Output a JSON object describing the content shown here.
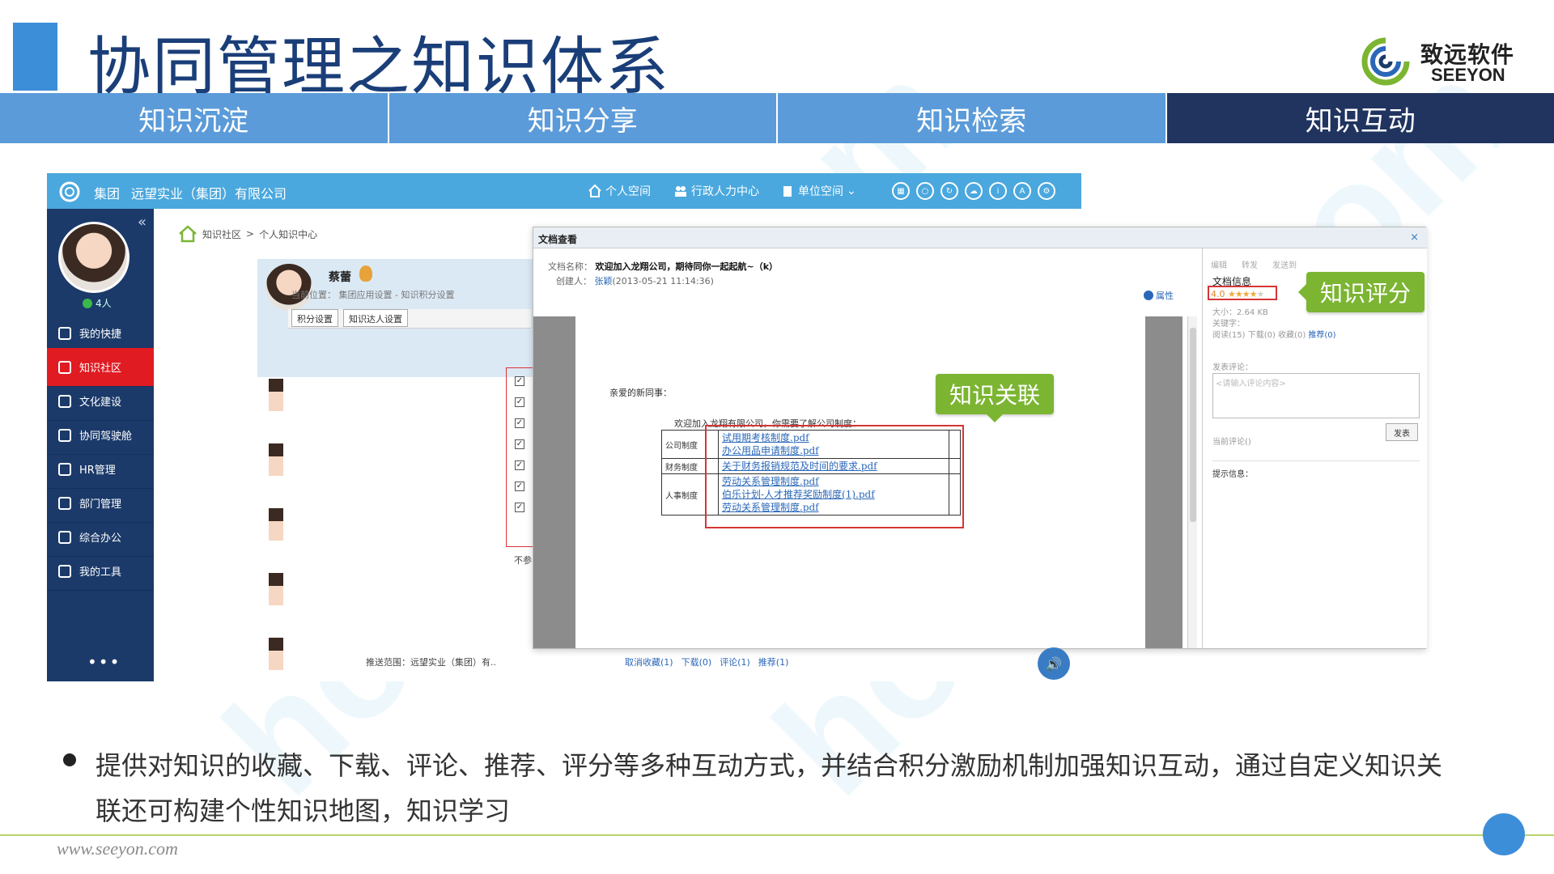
{
  "slide": {
    "title": "协同管理之知识体系",
    "logo_cn": "致远软件",
    "logo_en": "SEEYON",
    "tabs": [
      "知识沉淀",
      "知识分享",
      "知识检索",
      "知识互动"
    ],
    "active_tab_index": 3,
    "bullet_text": "提供对知识的收藏、下载、评论、推荐、评分等多种互动方式，并结合积分激励机制加强知识互动，通过自定义知识关联还可构建个性知识地图，知识学习",
    "footer_url": "www.seeyon.com",
    "watermark": "homedo.com",
    "colors": {
      "tab": "#5b9bd9",
      "tab_active": "#20345f",
      "title": "#1a3e78",
      "callout": "#7cb532",
      "accent_red": "#e01b22"
    }
  },
  "app": {
    "topbar": {
      "group": "集团",
      "company": "远望实业（集团）有限公司",
      "nav": [
        "个人空间",
        "行政人力中心",
        "单位空间"
      ],
      "icons": [
        "grid-icon",
        "search-icon",
        "refresh-icon",
        "cloud-icon",
        "info-icon",
        "text-size-icon",
        "settings-icon"
      ]
    },
    "sidebar": {
      "online": "4人",
      "items": [
        {
          "label": "我的快捷",
          "icon": "plus-icon"
        },
        {
          "label": "知识社区",
          "icon": "book-icon",
          "active": true
        },
        {
          "label": "文化建设",
          "icon": "building-icon"
        },
        {
          "label": "协同驾驶舱",
          "icon": "dashboard-icon"
        },
        {
          "label": "HR管理",
          "icon": "id-card-icon"
        },
        {
          "label": "部门管理",
          "icon": "org-chart-icon"
        },
        {
          "label": "综合办公",
          "icon": "office-icon"
        },
        {
          "label": "我的工具",
          "icon": "toolbox-icon"
        }
      ],
      "more": "•••"
    },
    "breadcrumb": {
      "root": "知识社区",
      "sep": ">",
      "current": "个人知识中心"
    },
    "person": {
      "name": "蔡蕾",
      "path": "当前位置：   集团应用设置 - 知识积分设置",
      "tabs": [
        "积分设置",
        "知识达人设置"
      ]
    },
    "content_note": "推送范围：远望实业（集团）有..",
    "not_shown": "不参",
    "actions": [
      "取消收藏(1)",
      "下载(0)",
      "评论(1)",
      "推荐(1)"
    ]
  },
  "viewer": {
    "title": "文档查看",
    "close": "×",
    "doc_name_label": "文档名称：",
    "doc_name": "欢迎加入龙翔公司，期待同你一起起航~（k）",
    "creator_label": "创建人：",
    "creator": "张颖",
    "created": "(2013-05-21 11:14:36)",
    "property": "属性",
    "greeting": "亲爱的新同事：",
    "intro": "欢迎加入龙翔有限公司，你需要了解公司制度：",
    "policies": [
      {
        "category": "公司制度",
        "files": [
          "试用期考核制度.pdf",
          "办公用品申请制度.pdf"
        ]
      },
      {
        "category": "财务制度",
        "files": [
          "关于财务报销规范及时间的要求.pdf"
        ]
      },
      {
        "category": "人事制度",
        "files": [
          "劳动关系管理制度.pdf",
          "伯乐计划-人才推荐奖励制度(1).pdf",
          "劳动关系管理制度.pdf"
        ]
      }
    ],
    "right": {
      "toolbar": [
        "编辑",
        "转发",
        "发送到"
      ],
      "section": "文档信息",
      "rating": "4.0",
      "stars_filled": 4,
      "stars_total": 5,
      "size": "大小：2.64 KB",
      "keywords": "关键字：",
      "stats_prefix": "阅读(15)  下载(0)  收藏(0)",
      "recommend": "推荐(0)",
      "comment_label": "发表评论：",
      "comment_placeholder": "<请输入评论内容>",
      "submit": "发表",
      "current_comments": "当前评论()",
      "hint": "提示信息："
    }
  },
  "callouts": {
    "rating": "知识评分",
    "link": "知识关联"
  }
}
